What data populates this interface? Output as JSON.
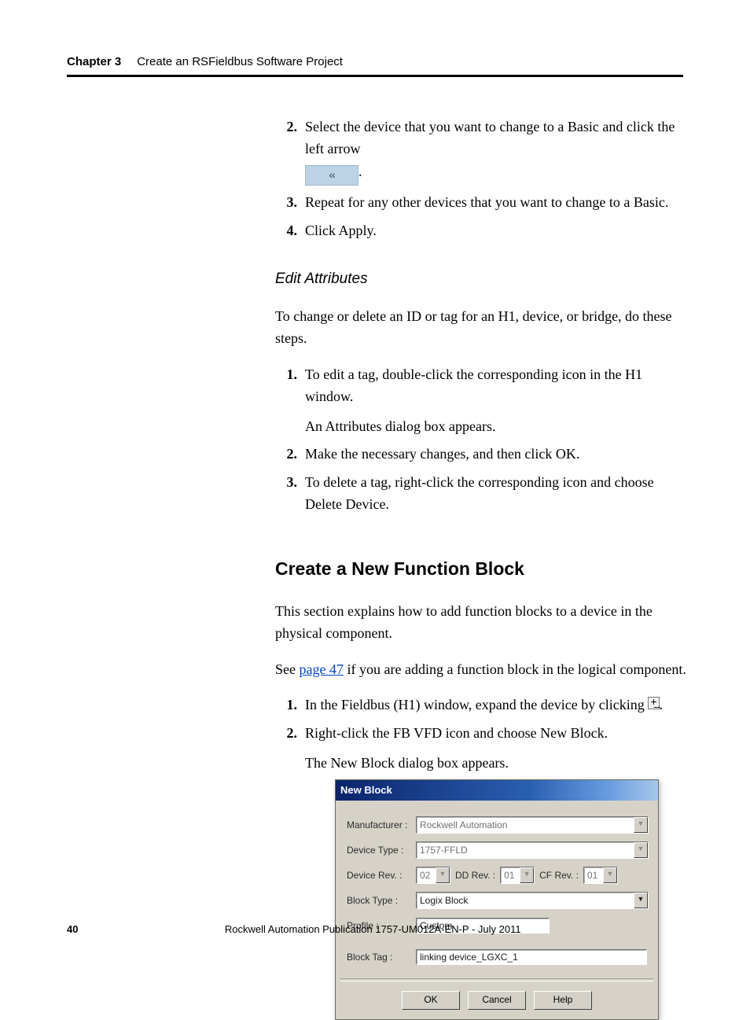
{
  "header": {
    "chapter": "Chapter 3",
    "title": "Create an RSFieldbus Software Project"
  },
  "steps_a": {
    "n2": "2.",
    "t2": "Select the device that you want to change to a Basic and click the left arrow",
    "arrow_label": "‹‹",
    "period": ".",
    "n3": "3.",
    "t3": "Repeat for any other devices that you want to change to a Basic.",
    "n4": "4.",
    "t4": "Click Apply."
  },
  "edit_attr": {
    "heading": "Edit Attributes",
    "intro": "To change or delete an ID or tag for an H1, device, or bridge, do these steps.",
    "n1": "1.",
    "t1": "To edit a tag, double-click the corresponding icon in the H1 window.",
    "t1b": "An Attributes dialog box appears.",
    "n2": "2.",
    "t2": "Make the necessary changes, and then click OK.",
    "n3": "3.",
    "t3": "To delete a tag, right-click the corresponding icon and choose Delete Device."
  },
  "create_block": {
    "heading": "Create a New Function Block",
    "intro": "This section explains how to add function blocks to a device in the physical component.",
    "see1": "See ",
    "link": "page 47",
    "see2": " if you are adding a function block in the logical component.",
    "n1": "1.",
    "t1a": "In the Fieldbus (H1) window, expand the device by clicking ",
    "t1b": ".",
    "expand_glyph": "+̲",
    "n2": "2.",
    "t2": "Right-click the FB VFD icon and choose New Block.",
    "appears": "The New Block dialog box appears."
  },
  "dialog": {
    "title": "New Block",
    "labels": {
      "manufacturer": "Manufacturer :",
      "device_type": "Device Type :",
      "device_rev": "Device Rev. :",
      "dd_rev": "DD Rev. :",
      "cf_rev": "CF Rev. :",
      "block_type": "Block Type :",
      "profile": "Profile :",
      "block_tag": "Block Tag :"
    },
    "values": {
      "manufacturer": "Rockwell Automation",
      "device_type": "1757-FFLD",
      "device_rev": "02",
      "dd_rev": "01",
      "cf_rev": "01",
      "block_type": "Logix Block",
      "profile": "Custom",
      "block_tag": "linking device_LGXC_1"
    },
    "buttons": {
      "ok": "OK",
      "cancel": "Cancel",
      "help": "Help"
    },
    "drop_glyph": "▼"
  },
  "footer": {
    "page": "40",
    "pub": "Rockwell Automation Publication 1757-UM012A-EN-P - July 2011"
  }
}
